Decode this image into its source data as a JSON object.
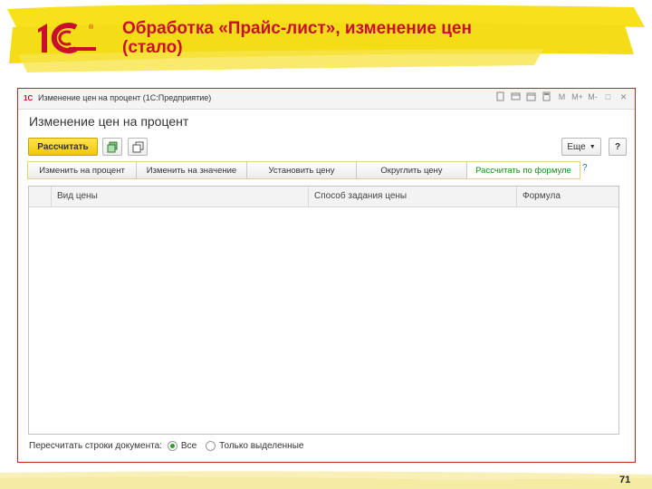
{
  "slide": {
    "title": "Обработка «Прайс-лист», изменение цен (стало)",
    "page_number": "71",
    "logo_text": "1С"
  },
  "window": {
    "title": "Изменение цен на процент (1С:Предприятие)",
    "titlebar_icons": [
      "doc-icon",
      "history-icon",
      "calendar-icon",
      "calc-icon",
      "m-icon",
      "mplus-icon",
      "mminus-icon",
      "maximize-icon",
      "close-icon"
    ],
    "titlebar_icon_glyphs": {
      "m": "M",
      "mplus": "M+",
      "mminus": "M-",
      "maximize": "□",
      "close": "✕"
    }
  },
  "form": {
    "title": "Изменение цен на процент",
    "calculate_label": "Рассчитать",
    "more_label": "Еще",
    "help_label": "?"
  },
  "tabs": [
    {
      "label": "Изменить на процент"
    },
    {
      "label": "Изменить на значение"
    },
    {
      "label": "Установить цену"
    },
    {
      "label": "Округлить цену"
    },
    {
      "label": "Рассчитать по формуле",
      "active": true
    }
  ],
  "tabs_help": "?",
  "grid": {
    "columns": [
      "Вид цены",
      "Способ задания цены",
      "Формула"
    ],
    "rows": []
  },
  "footer": {
    "label": "Пересчитать строки документа:",
    "options": [
      {
        "label": "Все",
        "selected": true
      },
      {
        "label": "Только выделенные",
        "selected": false
      }
    ]
  },
  "colors": {
    "accent_red": "#c8102e",
    "highlight_yellow": "#f6e11b",
    "active_tab_green": "#1a8a1a"
  }
}
